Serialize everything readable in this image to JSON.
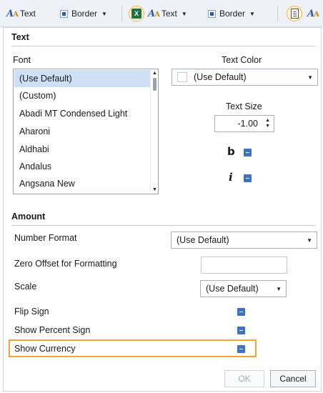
{
  "toolbar": {
    "text1_label": "Text",
    "border1_label": "Border",
    "text2_label": "Text",
    "border2_label": "Border",
    "excel_icon_text": "X"
  },
  "text_section": {
    "title": "Text",
    "font_label": "Font",
    "font_list": [
      "(Use Default)",
      "(Custom)",
      "Abadi MT Condensed Light",
      "Aharoni",
      "Aldhabi",
      "Andalus",
      "Angsana New"
    ],
    "selected_font": "(Use Default)",
    "text_color_label": "Text Color",
    "text_color_value": "(Use Default)",
    "text_size_label": "Text Size",
    "text_size_value": "-1.00",
    "bold_glyph": "b",
    "italic_glyph": "i"
  },
  "amount_section": {
    "title": "Amount",
    "number_format_label": "Number Format",
    "number_format_value": "(Use Default)",
    "zero_offset_label": "Zero Offset for Formatting",
    "zero_offset_value": "",
    "scale_label": "Scale",
    "scale_value": "(Use Default)",
    "flip_sign_label": "Flip Sign",
    "show_percent_label": "Show Percent Sign",
    "show_currency_label": "Show Currency"
  },
  "buttons": {
    "ok": "OK",
    "cancel": "Cancel"
  },
  "colors": {
    "accent": "#3d74c2",
    "highlight": "#f0a431",
    "selection": "#cfe0f6"
  }
}
